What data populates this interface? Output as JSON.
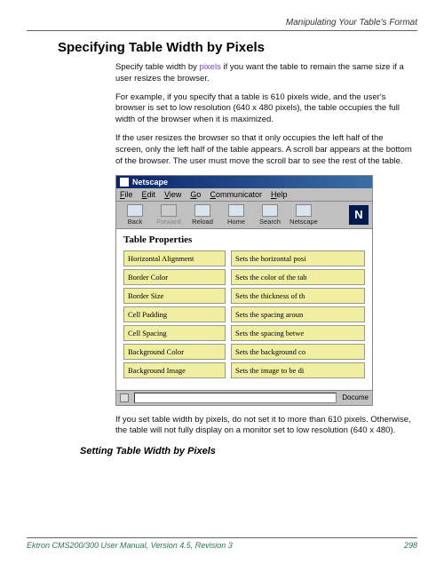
{
  "header": {
    "chapter": "Manipulating Your Table's Format"
  },
  "section": {
    "title": "Specifying Table Width by Pixels"
  },
  "para1a": "Specify table width by ",
  "para1link": "pixels",
  "para1b": " if you want the table to remain the same size if a user resizes the browser.",
  "para2": "For example, if you specify that a table is 610 pixels wide, and the user's browser is set to low resolution (640 x 480 pixels), the table occupies the full width of the browser when it is maximized.",
  "para3": "If the user resizes the browser so that it only occupies the left half of the screen, only the left half of the table appears. A scroll bar appears at the bottom of the browser. The user must move the scroll bar to see the rest of the table.",
  "para4": "If you set table width by pixels, do not set it to more than 610 pixels. Otherwise, the table will not fully display on a monitor set to low resolution (640 x 480).",
  "subsection": {
    "title": "Setting Table Width by Pixels"
  },
  "footer": {
    "manual": "Ektron CMS200/300 User Manual, Version 4.5, Revision 3",
    "page": "298"
  },
  "screenshot": {
    "app": "Netscape",
    "menu": [
      "File",
      "Edit",
      "View",
      "Go",
      "Communicator",
      "Help"
    ],
    "toolbar": [
      {
        "label": "Back",
        "disabled": false
      },
      {
        "label": "Forward",
        "disabled": true
      },
      {
        "label": "Reload",
        "disabled": false
      },
      {
        "label": "Home",
        "disabled": false
      },
      {
        "label": "Search",
        "disabled": false
      },
      {
        "label": "Netscape",
        "disabled": false
      }
    ],
    "nbadge": "N",
    "tp_title": "Table Properties",
    "rows": [
      {
        "l": "Horizontal Alignment",
        "r": "Sets the horizontal posi"
      },
      {
        "l": "Border Color",
        "r": "Sets the color of the tab"
      },
      {
        "l": "Border Size",
        "r": "Sets the thickness of th"
      },
      {
        "l": "Cell Padding",
        "r": "Sets the spacing aroun"
      },
      {
        "l": "Cell Spacing",
        "r": "Sets the spacing betwe"
      },
      {
        "l": "Background Color",
        "r": "Sets the background co"
      },
      {
        "l": "Background Image",
        "r": "Sets the image to be di"
      }
    ],
    "status": "Docume"
  }
}
